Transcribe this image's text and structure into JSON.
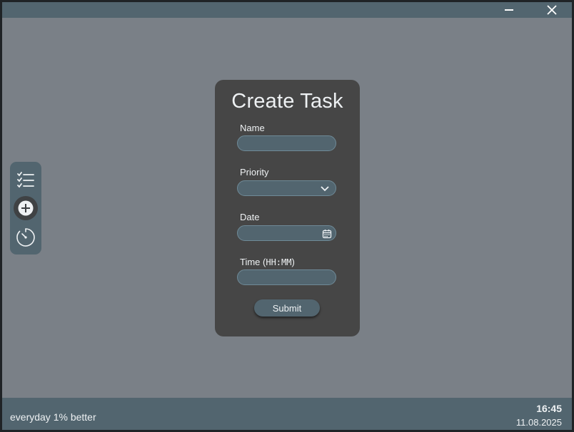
{
  "window": {
    "minimize_icon": "minimize-icon",
    "close_icon": "close-icon"
  },
  "sidebar": {
    "items": [
      {
        "icon": "task-list-icon",
        "active": false
      },
      {
        "icon": "add-circle-icon",
        "active": true
      },
      {
        "icon": "timer-icon",
        "active": false
      }
    ]
  },
  "form": {
    "title": "Create Task",
    "name_label": "Name",
    "name_value": "",
    "priority_label": "Priority",
    "priority_value": "",
    "date_label": "Date",
    "date_value": "",
    "time_label_prefix": "Time (",
    "time_label_format": "HH:MM",
    "time_label_suffix": ")",
    "time_value": "",
    "submit_label": "Submit"
  },
  "status": {
    "motto": "everyday 1% better",
    "time": "16:45",
    "date": "11.08.2025"
  },
  "colors": {
    "background": "#7a8087",
    "bar": "#52656f",
    "card": "#464646",
    "text": "#eef1f3"
  }
}
